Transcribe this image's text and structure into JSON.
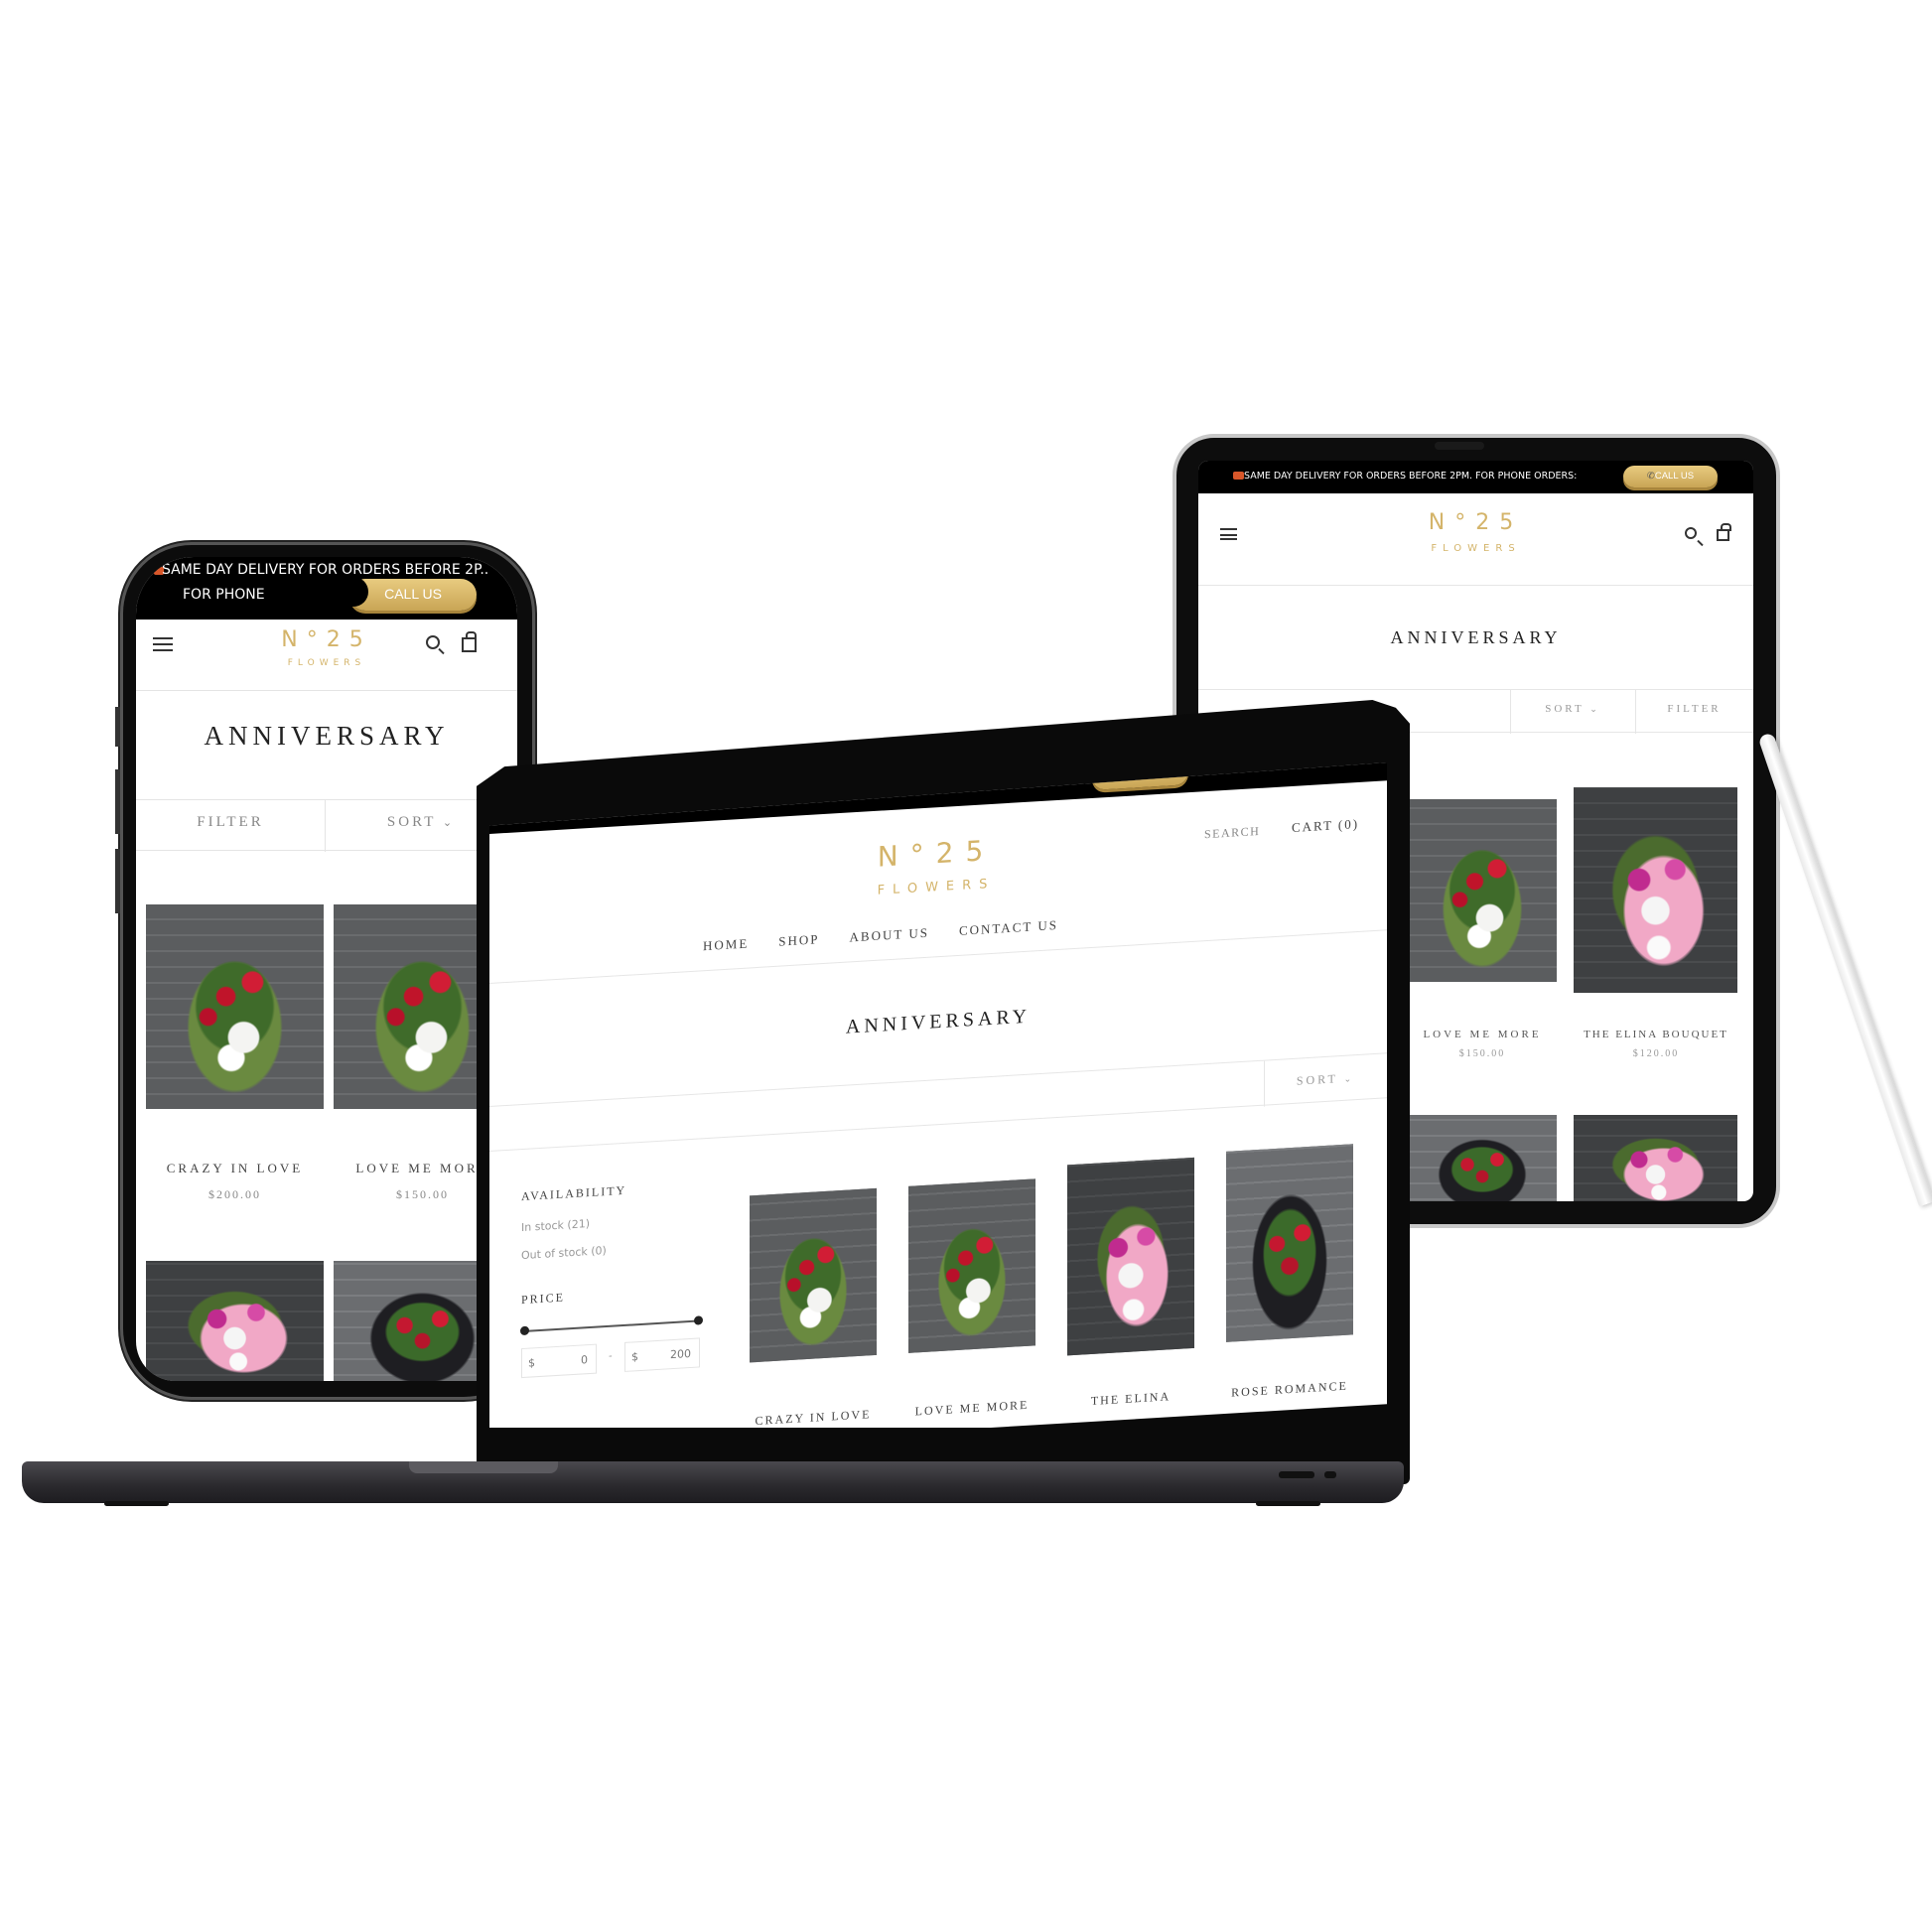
{
  "banner": {
    "text": "SAME DAY DELIVERY FOR ORDERS BEFORE 2PM. FOR PHONE ORDERS:",
    "phone_line1": "SAME DAY DELIVERY FOR ORDERS BEFORE 2P..",
    "phone_line2": "FOR PHONE",
    "call_label": "CALL US",
    "truck_icon": "delivery-truck-icon",
    "phone_icon": "phone-icon"
  },
  "brand": {
    "mark": "N°25",
    "sub": "FLOWERS",
    "color": "#d4b46a"
  },
  "page_title": "ANNIVERSARY",
  "phone": {
    "filter_label": "FILTER",
    "sort_label": "SORT",
    "products": [
      {
        "name": "CRAZY IN LOVE",
        "price": "$200.00"
      },
      {
        "name": "LOVE ME MORE",
        "price": "$150.00"
      }
    ]
  },
  "tablet": {
    "sort_label": "SORT",
    "filter_label": "FILTER",
    "products": [
      {
        "name": "LOVE ME MORE",
        "price": "$150.00"
      },
      {
        "name": "THE ELINA BOUQUET",
        "price": "$120.00"
      }
    ]
  },
  "laptop": {
    "search_label": "SEARCH",
    "cart_label": "CART (0)",
    "nav": [
      "HOME",
      "SHOP",
      "ABOUT US",
      "CONTACT US"
    ],
    "sort_label": "SORT",
    "filters": {
      "availability_label": "AVAILABILITY",
      "in_stock": "In stock (21)",
      "out_of_stock": "Out of stock (0)",
      "price_label": "PRICE",
      "currency": "$",
      "min": "0",
      "max": "200",
      "separator": "-"
    },
    "products": [
      "CRAZY IN LOVE",
      "LOVE ME MORE",
      "THE ELINA",
      "ROSE ROMANCE"
    ]
  }
}
